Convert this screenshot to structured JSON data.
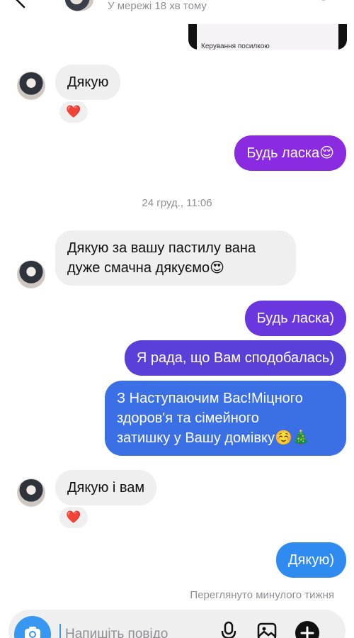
{
  "header": {
    "status": "У мережі 18 хв тому"
  },
  "shared_post": {
    "caption": "Керування посилкою"
  },
  "messages": [
    {
      "text": "Дякую",
      "reaction": "❤️"
    },
    {
      "text": "Будь ласка😌"
    },
    {
      "text_line1": "Дякую за вашу пастилу вана",
      "text_line2": "дуже смачна дякуємо😍"
    },
    {
      "text": "Будь ласка)"
    },
    {
      "text": "Я рада, що Вам сподобалась)"
    },
    {
      "text_line1": "З Наступаючим Вас!Міцного",
      "text_line2": "здоров'я та сімейного",
      "text_line3": "затишку у Вашу домівку☺️🎄"
    },
    {
      "text": "Дякую і вам",
      "reaction": "❤️"
    },
    {
      "text": "Дякую)"
    }
  ],
  "timestamp": "24 груд., 11:06",
  "seen_status": "Переглянуто минулого тижня",
  "composer": {
    "placeholder": "Напишіть повідо"
  },
  "colors": {
    "out_purple": "#8a2be2",
    "out_indigo": "#5a3fd8",
    "out_blue": "#3b6fe6",
    "out_sky": "#2f8bef",
    "incoming": "#efefef",
    "accent": "#3897f0"
  },
  "icons": [
    "back-arrow-icon",
    "video-call-icon",
    "flag-icon",
    "info-icon",
    "camera-icon",
    "microphone-icon",
    "gallery-icon",
    "plus-icon"
  ]
}
